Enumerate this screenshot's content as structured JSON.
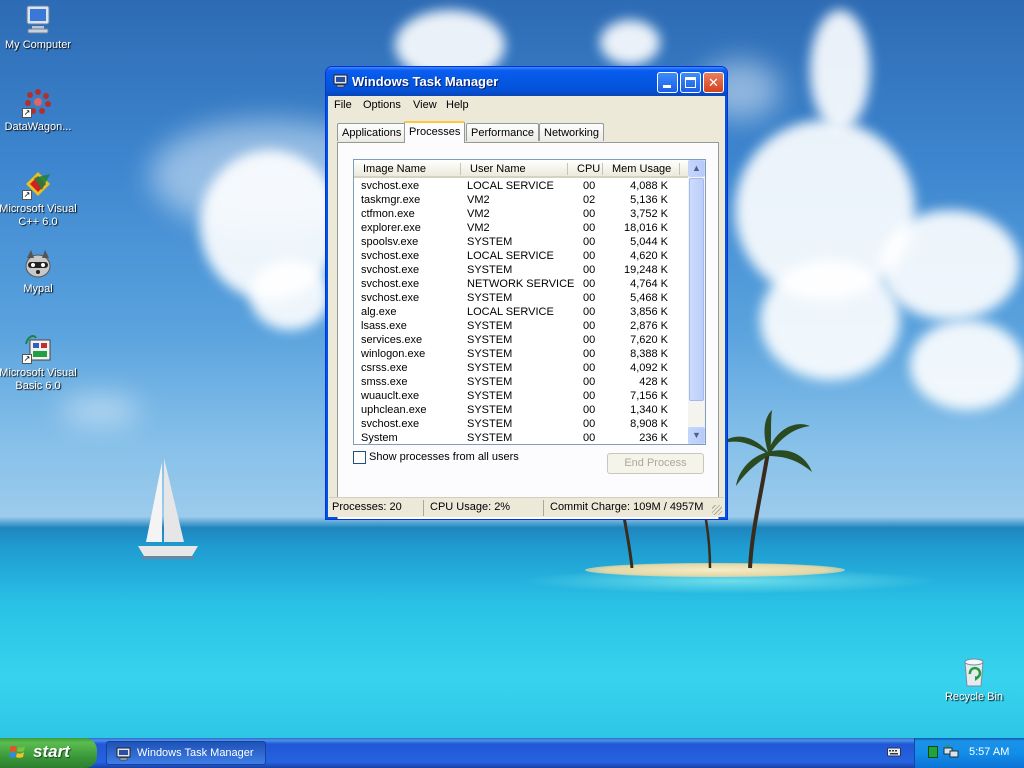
{
  "colors": {
    "titlebar": "#0458e3",
    "taskbar": "#2663e0",
    "start": "#3c9a3c",
    "window_face": "#ece9d8"
  },
  "desktop": {
    "icons": [
      {
        "label": "My Computer",
        "icon": "my-computer-icon"
      },
      {
        "label": "DataWagon...",
        "icon": "datawagon-icon"
      },
      {
        "label": "Microsoft Visual C++ 6.0",
        "icon": "visual-cpp-icon"
      },
      {
        "label": "Mypal",
        "icon": "mypal-icon"
      },
      {
        "label": "Microsoft Visual Basic 6.0",
        "icon": "visual-basic-icon"
      },
      {
        "label": "Recycle Bin",
        "icon": "recycle-bin-icon"
      }
    ]
  },
  "window": {
    "title": "Windows Task Manager",
    "menu": [
      "File",
      "Options",
      "View",
      "Help"
    ],
    "tabs": [
      "Applications",
      "Processes",
      "Performance",
      "Networking"
    ],
    "active_tab": "Processes",
    "columns": [
      "Image Name",
      "User Name",
      "CPU",
      "Mem Usage"
    ],
    "processes": [
      {
        "name": "svchost.exe",
        "user": "LOCAL SERVICE",
        "cpu": "00",
        "mem": "4,088 K"
      },
      {
        "name": "taskmgr.exe",
        "user": "VM2",
        "cpu": "02",
        "mem": "5,136 K"
      },
      {
        "name": "ctfmon.exe",
        "user": "VM2",
        "cpu": "00",
        "mem": "3,752 K"
      },
      {
        "name": "explorer.exe",
        "user": "VM2",
        "cpu": "00",
        "mem": "18,016 K"
      },
      {
        "name": "spoolsv.exe",
        "user": "SYSTEM",
        "cpu": "00",
        "mem": "5,044 K"
      },
      {
        "name": "svchost.exe",
        "user": "LOCAL SERVICE",
        "cpu": "00",
        "mem": "4,620 K"
      },
      {
        "name": "svchost.exe",
        "user": "SYSTEM",
        "cpu": "00",
        "mem": "19,248 K"
      },
      {
        "name": "svchost.exe",
        "user": "NETWORK SERVICE",
        "cpu": "00",
        "mem": "4,764 K"
      },
      {
        "name": "svchost.exe",
        "user": "SYSTEM",
        "cpu": "00",
        "mem": "5,468 K"
      },
      {
        "name": "alg.exe",
        "user": "LOCAL SERVICE",
        "cpu": "00",
        "mem": "3,856 K"
      },
      {
        "name": "lsass.exe",
        "user": "SYSTEM",
        "cpu": "00",
        "mem": "2,876 K"
      },
      {
        "name": "services.exe",
        "user": "SYSTEM",
        "cpu": "00",
        "mem": "7,620 K"
      },
      {
        "name": "winlogon.exe",
        "user": "SYSTEM",
        "cpu": "00",
        "mem": "8,388 K"
      },
      {
        "name": "csrss.exe",
        "user": "SYSTEM",
        "cpu": "00",
        "mem": "4,092 K"
      },
      {
        "name": "smss.exe",
        "user": "SYSTEM",
        "cpu": "00",
        "mem": "428 K"
      },
      {
        "name": "wuauclt.exe",
        "user": "SYSTEM",
        "cpu": "00",
        "mem": "7,156 K"
      },
      {
        "name": "uphclean.exe",
        "user": "SYSTEM",
        "cpu": "00",
        "mem": "1,340 K"
      },
      {
        "name": "svchost.exe",
        "user": "SYSTEM",
        "cpu": "00",
        "mem": "8,908 K"
      },
      {
        "name": "System",
        "user": "SYSTEM",
        "cpu": "00",
        "mem": "236 K"
      }
    ],
    "show_all_label": "Show processes from all users",
    "show_all_checked": false,
    "end_process_label": "End Process",
    "status": {
      "processes": "Processes: 20",
      "cpu": "CPU Usage: 2%",
      "commit": "Commit Charge: 109M / 4957M"
    }
  },
  "taskbar": {
    "start_label": "start",
    "task_button_label": "Windows Task Manager",
    "clock": "5:57 AM"
  }
}
